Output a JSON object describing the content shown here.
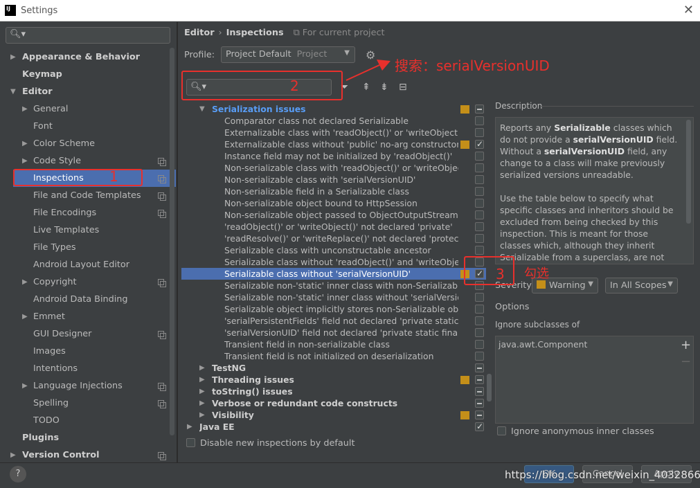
{
  "window": {
    "title": "Settings",
    "logo": "IJ"
  },
  "left_tree": {
    "items": [
      {
        "label": "Appearance & Behavior",
        "level": 0,
        "bold": true,
        "arrow": "▶"
      },
      {
        "label": "Keymap",
        "level": 0,
        "bold": true,
        "arrow": ""
      },
      {
        "label": "Editor",
        "level": 0,
        "bold": true,
        "arrow": "▼"
      },
      {
        "label": "General",
        "level": 1,
        "bold": false,
        "arrow": "▶"
      },
      {
        "label": "Font",
        "level": 1,
        "bold": false,
        "arrow": ""
      },
      {
        "label": "Color Scheme",
        "level": 1,
        "bold": false,
        "arrow": "▶"
      },
      {
        "label": "Code Style",
        "level": 1,
        "bold": false,
        "arrow": "▶",
        "copy": true
      },
      {
        "label": "Inspections",
        "level": 1,
        "bold": false,
        "arrow": "",
        "copy": true,
        "selected": true
      },
      {
        "label": "File and Code Templates",
        "level": 1,
        "bold": false,
        "arrow": "",
        "copy": true
      },
      {
        "label": "File Encodings",
        "level": 1,
        "bold": false,
        "arrow": "",
        "copy": true
      },
      {
        "label": "Live Templates",
        "level": 1,
        "bold": false,
        "arrow": ""
      },
      {
        "label": "File Types",
        "level": 1,
        "bold": false,
        "arrow": ""
      },
      {
        "label": "Android Layout Editor",
        "level": 1,
        "bold": false,
        "arrow": ""
      },
      {
        "label": "Copyright",
        "level": 1,
        "bold": false,
        "arrow": "▶",
        "copy": true
      },
      {
        "label": "Android Data Binding",
        "level": 1,
        "bold": false,
        "arrow": ""
      },
      {
        "label": "Emmet",
        "level": 1,
        "bold": false,
        "arrow": "▶"
      },
      {
        "label": "GUI Designer",
        "level": 1,
        "bold": false,
        "arrow": "",
        "copy": true
      },
      {
        "label": "Images",
        "level": 1,
        "bold": false,
        "arrow": ""
      },
      {
        "label": "Intentions",
        "level": 1,
        "bold": false,
        "arrow": ""
      },
      {
        "label": "Language Injections",
        "level": 1,
        "bold": false,
        "arrow": "▶",
        "copy": true
      },
      {
        "label": "Spelling",
        "level": 1,
        "bold": false,
        "arrow": "",
        "copy": true
      },
      {
        "label": "TODO",
        "level": 1,
        "bold": false,
        "arrow": ""
      },
      {
        "label": "Plugins",
        "level": 0,
        "bold": true,
        "arrow": ""
      },
      {
        "label": "Version Control",
        "level": 0,
        "bold": true,
        "arrow": "▶",
        "copy": true
      }
    ]
  },
  "breadcrumb": {
    "editor": "Editor",
    "sep": "›",
    "inspections": "Inspections",
    "scope_icon": "⧉",
    "scope": "For current project"
  },
  "profile": {
    "label": "Profile:",
    "value": "Project Default",
    "kind": "Project"
  },
  "annotations": {
    "box1_num": "1",
    "box2_num": "2",
    "box3_num": "3",
    "search_note": "搜索：serialVersionUID",
    "check_note": "勾选",
    "color": "#e8302c"
  },
  "inspections": {
    "rows": [
      {
        "label": "Serialization issues",
        "indent": 1,
        "group": true,
        "arrow": "▼",
        "sev": true,
        "check": "minus",
        "highlight": true
      },
      {
        "label": "Comparator class not declared Serializable",
        "indent": 2,
        "check": "empty"
      },
      {
        "label": "Externalizable class with 'readObject()' or 'writeObject()'",
        "indent": 2,
        "check": "empty"
      },
      {
        "label": "Externalizable class without 'public' no-arg constructor",
        "indent": 2,
        "sev": true,
        "check": "checked"
      },
      {
        "label": "Instance field may not be initialized by 'readObject()'",
        "indent": 2,
        "check": "empty"
      },
      {
        "label": "Non-serializable class with 'readObject()' or 'writeObject()'",
        "indent": 2,
        "check": "empty"
      },
      {
        "label": "Non-serializable class with 'serialVersionUID'",
        "indent": 2,
        "check": "empty"
      },
      {
        "label": "Non-serializable field in a Serializable class",
        "indent": 2,
        "check": "empty"
      },
      {
        "label": "Non-serializable object bound to HttpSession",
        "indent": 2,
        "check": "empty"
      },
      {
        "label": "Non-serializable object passed to ObjectOutputStream",
        "indent": 2,
        "check": "empty"
      },
      {
        "label": "'readObject()' or 'writeObject()' not declared 'private'",
        "indent": 2,
        "check": "empty"
      },
      {
        "label": "'readResolve()' or 'writeReplace()' not declared 'protected'",
        "indent": 2,
        "check": "empty"
      },
      {
        "label": "Serializable class with unconstructable ancestor",
        "indent": 2,
        "check": "empty"
      },
      {
        "label": "Serializable class without 'readObject()' and 'writeObject()'",
        "indent": 2,
        "check": "empty"
      },
      {
        "label": "Serializable class without 'serialVersionUID'",
        "indent": 2,
        "sev": true,
        "check": "checked",
        "selected": true
      },
      {
        "label": "Serializable non-'static' inner class with non-Serializable outer",
        "indent": 2,
        "check": "empty"
      },
      {
        "label": "Serializable non-'static' inner class without 'serialVersionUID'",
        "indent": 2,
        "check": "empty"
      },
      {
        "label": "Serializable object implicitly stores non-Serializable object",
        "indent": 2,
        "check": "empty"
      },
      {
        "label": "'serialPersistentFields' field not declared 'private static final'",
        "indent": 2,
        "check": "empty"
      },
      {
        "label": "'serialVersionUID' field not declared 'private static final long'",
        "indent": 2,
        "check": "empty"
      },
      {
        "label": "Transient field in non-serializable class",
        "indent": 2,
        "check": "empty"
      },
      {
        "label": "Transient field is not initialized on deserialization",
        "indent": 2,
        "check": "empty"
      },
      {
        "label": "TestNG",
        "indent": 1,
        "group": true,
        "arrow": "▶",
        "check": "minus"
      },
      {
        "label": "Threading issues",
        "indent": 1,
        "group": true,
        "arrow": "▶",
        "sev": true,
        "check": "minus"
      },
      {
        "label": "toString() issues",
        "indent": 1,
        "group": true,
        "arrow": "▶",
        "check": "minus"
      },
      {
        "label": "Verbose or redundant code constructs",
        "indent": 1,
        "group": true,
        "arrow": "▶",
        "check": "minus"
      },
      {
        "label": "Visibility",
        "indent": 1,
        "group": true,
        "arrow": "▶",
        "sev": true,
        "check": "minus"
      },
      {
        "label": "Java EE",
        "indent": 0,
        "group": true,
        "arrow": "▶",
        "check": "checked"
      }
    ]
  },
  "disable_new": "Disable new inspections by default",
  "description": {
    "title": "Description",
    "p1_a": "Reports any ",
    "p1_b": "Serializable",
    "p1_c": " classes which do not provide a ",
    "p1_d": "serialVersionUID",
    "p1_e": " field. Without a ",
    "p1_f": "serialVersionUID",
    "p1_g": " field, any change to a class will make previously serialized versions unreadable.",
    "p2": "Use the table below to specify what specific classes and inheritors should be excluded from being checked by this inspection. This is meant for those classes which, although they inherit Serializable from a superclass, are not intended for serialization. Such"
  },
  "severity": {
    "label": "Severity:",
    "value": "Warning",
    "scope": "In All Scopes",
    "color": "#c48f19"
  },
  "options": {
    "label": "Options",
    "ignore_label": "Ignore subclasses of",
    "ignore_items": [
      "java.awt.Component"
    ],
    "anon": "Ignore anonymous inner classes"
  },
  "buttons": {
    "help": "?",
    "ok": "OK",
    "cancel": "Cancel",
    "apply": "Apply"
  },
  "watermark": "https://blog.csdn.net/weixin_40328662",
  "colors": {
    "selection": "#4b6eaf",
    "severity_warning": "#c48f19",
    "group_highlight": "#589df6"
  }
}
